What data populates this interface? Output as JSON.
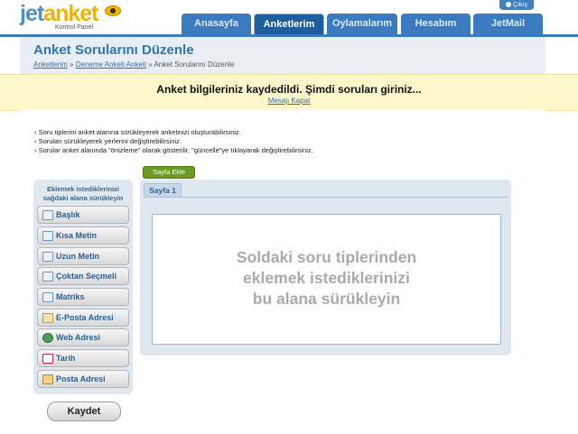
{
  "brand": {
    "logo_jet": "jet",
    "logo_anket": "anket",
    "subtitle": "Kontrol Panel"
  },
  "header": {
    "logout_label": "Çıkış",
    "tabs": [
      {
        "label": "Anasayfa",
        "active": false
      },
      {
        "label": "Anketlerim",
        "active": true
      },
      {
        "label": "Oylamalarım",
        "active": false
      },
      {
        "label": "Hesabım",
        "active": false
      },
      {
        "label": "JetMail",
        "active": false
      }
    ]
  },
  "page": {
    "title": "Anket Sorularını Düzenle",
    "breadcrumb": [
      "Anketlerim",
      "Deneme Anketi Anketi",
      "Anket Sorularını Düzenle"
    ],
    "breadcrumb_sep": "»"
  },
  "notice": {
    "message": "Anket bilgileriniz kaydedildi. Şimdi soruları giriniz...",
    "close_label": "Mesajı Kapat"
  },
  "instructions": [
    "› Soru tiplerini anket alanına sürükleyerek anketinizi oluşturabilirsiniz.",
    "› Soruları sürükleyerek yerlerini değiştirebilirsiniz.",
    "› Sorular anket alanında \"önizleme\" olarak gösterilir, \"güncelle\"ye tıklayarak değiştirebilirsiniz."
  ],
  "sidebar": {
    "heading_line1": "Eklemek istediklerinizi",
    "heading_line2": "sağdaki alana sürükleyin",
    "items": [
      {
        "label": "Başlık",
        "icon": "heading-icon"
      },
      {
        "label": "Kısa Metin",
        "icon": "short-text-icon"
      },
      {
        "label": "Uzun Metin",
        "icon": "long-text-icon"
      },
      {
        "label": "Çoktan Seçmeli",
        "icon": "multiple-choice-icon"
      },
      {
        "label": "Matriks",
        "icon": "matrix-icon"
      },
      {
        "label": "E-Posta Adresi",
        "icon": "email-icon"
      },
      {
        "label": "Web Adresi",
        "icon": "globe-icon"
      },
      {
        "label": "Tarih",
        "icon": "calendar-icon"
      },
      {
        "label": "Posta Adresi",
        "icon": "home-icon"
      }
    ],
    "save_label": "Kaydet"
  },
  "editor": {
    "add_page_label": "Sayfa Ekle",
    "page_tab_label": "Sayfa 1",
    "dropzone_line1": "Soldaki soru tiplerinden",
    "dropzone_line2": "eklemek istediklerinizi",
    "dropzone_line3": "bu alana sürükleyin"
  },
  "colors": {
    "brand_blue": "#3a7bbf",
    "brand_yellow": "#f0b400",
    "notice_bg": "#fcf8cc",
    "add_page_green": "#6a9c22"
  }
}
